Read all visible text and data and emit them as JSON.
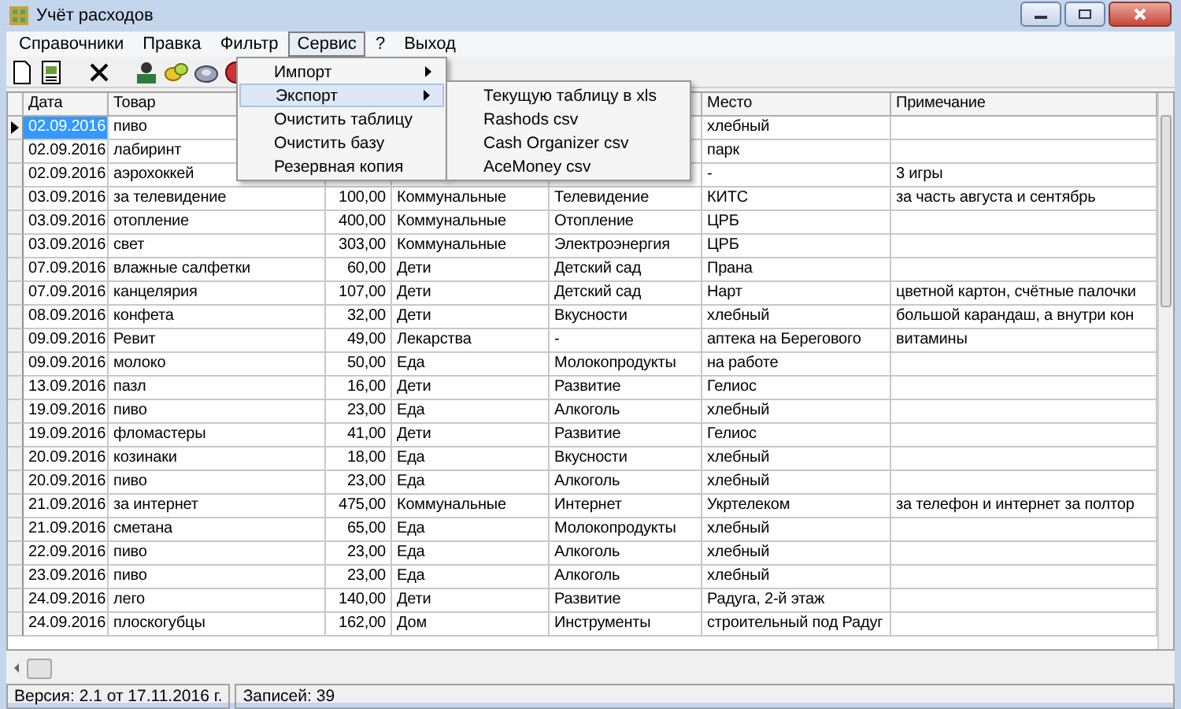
{
  "window": {
    "title": "Учёт расходов"
  },
  "menu_bar": [
    {
      "label": "Справочники",
      "selected": false
    },
    {
      "label": "Правка",
      "selected": false
    },
    {
      "label": "Фильтр",
      "selected": false
    },
    {
      "label": "Сервис",
      "selected": true
    },
    {
      "label": "?",
      "selected": false
    },
    {
      "label": "Выход",
      "selected": false
    }
  ],
  "service_menu": [
    {
      "label": "Импорт",
      "submenu": true,
      "selected": false
    },
    {
      "label": "Экспорт",
      "submenu": true,
      "selected": true
    },
    {
      "label": "Очистить таблицу",
      "submenu": false,
      "selected": false
    },
    {
      "label": "Очистить базу",
      "submenu": false,
      "selected": false
    },
    {
      "label": "Резервная копия",
      "submenu": false,
      "selected": false
    }
  ],
  "export_submenu": [
    "Текущую таблицу в xls",
    "Rashods csv",
    "Cash Organizer csv",
    "AceMoney csv"
  ],
  "table": {
    "columns": [
      "Дата",
      "Товар",
      null,
      null,
      null,
      "Место",
      "Примечание"
    ],
    "rows": [
      {
        "selected": true,
        "cells": [
          "02.09.2016",
          "пиво",
          null,
          null,
          null,
          "хлебный",
          null
        ]
      },
      {
        "selected": false,
        "cells": [
          "02.09.2016",
          "лабиринт",
          null,
          null,
          null,
          "парк",
          null
        ]
      },
      {
        "selected": false,
        "cells": [
          "02.09.2016",
          "аэрохоккей",
          null,
          null,
          null,
          "-",
          "3 игры"
        ]
      },
      {
        "selected": false,
        "cells": [
          "03.09.2016",
          "за телевидение",
          "100,00",
          "Коммунальные",
          "Телевидение",
          "КИТС",
          "за часть августа и сентябрь"
        ]
      },
      {
        "selected": false,
        "cells": [
          "03.09.2016",
          "отопление",
          "400,00",
          "Коммунальные",
          "Отопление",
          "ЦРБ",
          null
        ]
      },
      {
        "selected": false,
        "cells": [
          "03.09.2016",
          "свет",
          "303,00",
          "Коммунальные",
          "Электроэнергия",
          "ЦРБ",
          null
        ]
      },
      {
        "selected": false,
        "cells": [
          "07.09.2016",
          "влажные салфетки",
          "60,00",
          "Дети",
          "Детский сад",
          "Прана",
          null
        ]
      },
      {
        "selected": false,
        "cells": [
          "07.09.2016",
          "канцелярия",
          "107,00",
          "Дети",
          "Детский сад",
          "Нарт",
          "цветной картон, счётные палочки"
        ]
      },
      {
        "selected": false,
        "cells": [
          "08.09.2016",
          "конфета",
          "32,00",
          "Дети",
          "Вкусности",
          "хлебный",
          "большой карандаш, а внутри кон"
        ]
      },
      {
        "selected": false,
        "cells": [
          "09.09.2016",
          "Ревит",
          "49,00",
          "Лекарства",
          "-",
          "аптека на Берегового",
          "витамины"
        ]
      },
      {
        "selected": false,
        "cells": [
          "09.09.2016",
          "молоко",
          "50,00",
          "Еда",
          "Молокопродукты",
          "на работе",
          null
        ]
      },
      {
        "selected": false,
        "cells": [
          "13.09.2016",
          "пазл",
          "16,00",
          "Дети",
          "Развитие",
          "Гелиос",
          null
        ]
      },
      {
        "selected": false,
        "cells": [
          "19.09.2016",
          "пиво",
          "23,00",
          "Еда",
          "Алкоголь",
          "хлебный",
          null
        ]
      },
      {
        "selected": false,
        "cells": [
          "19.09.2016",
          "фломастеры",
          "41,00",
          "Дети",
          "Развитие",
          "Гелиос",
          null
        ]
      },
      {
        "selected": false,
        "cells": [
          "20.09.2016",
          "козинаки",
          "18,00",
          "Еда",
          "Вкусности",
          "хлебный",
          null
        ]
      },
      {
        "selected": false,
        "cells": [
          "20.09.2016",
          "пиво",
          "23,00",
          "Еда",
          "Алкоголь",
          "хлебный",
          null
        ]
      },
      {
        "selected": false,
        "cells": [
          "21.09.2016",
          "за интернет",
          "475,00",
          "Коммунальные",
          "Интернет",
          "Укртелеком",
          "за телефон и интернет за полтор"
        ]
      },
      {
        "selected": false,
        "cells": [
          "21.09.2016",
          "сметана",
          "65,00",
          "Еда",
          "Молокопродукты",
          "хлебный",
          null
        ]
      },
      {
        "selected": false,
        "cells": [
          "22.09.2016",
          "пиво",
          "23,00",
          "Еда",
          "Алкоголь",
          "хлебный",
          null
        ]
      },
      {
        "selected": false,
        "cells": [
          "23.09.2016",
          "пиво",
          "23,00",
          "Еда",
          "Алкоголь",
          "хлебный",
          null
        ]
      },
      {
        "selected": false,
        "cells": [
          "24.09.2016",
          "лего",
          "140,00",
          "Дети",
          "Развитие",
          "Радуга, 2-й этаж",
          null
        ]
      },
      {
        "selected": false,
        "cells": [
          "24.09.2016",
          "плоскогубцы",
          "162,00",
          "Дом",
          "Инструменты",
          "строительный под Радуг",
          null
        ]
      }
    ]
  },
  "status_bar": {
    "version": "Версия: 2.1 от 17.11.2016 г.",
    "records": "Записей: 39"
  }
}
